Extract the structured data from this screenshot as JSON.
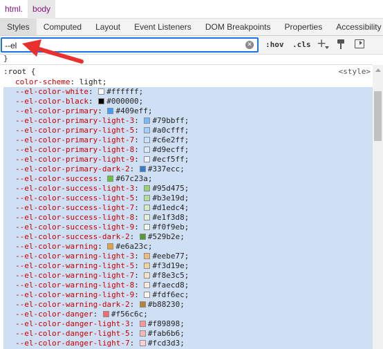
{
  "breadcrumb": {
    "items": [
      "html.",
      "body"
    ]
  },
  "tabs": [
    "Styles",
    "Computed",
    "Layout",
    "Event Listeners",
    "DOM Breakpoints",
    "Properties",
    "Accessibility"
  ],
  "filter": {
    "value": "--el",
    "hov": ":hov",
    "cls": ".cls"
  },
  "closing_brace": "}",
  "rule": {
    "selector": ":root {",
    "origin": "<style>",
    "color_scheme": {
      "prop": "color-scheme",
      "value": "light"
    },
    "declarations": [
      {
        "prop": "--el-color-white",
        "value": "#ffffff"
      },
      {
        "prop": "--el-color-black",
        "value": "#000000"
      },
      {
        "prop": "--el-color-primary",
        "value": "#409eff"
      },
      {
        "prop": "--el-color-primary-light-3",
        "value": "#79bbff"
      },
      {
        "prop": "--el-color-primary-light-5",
        "value": "#a0cfff"
      },
      {
        "prop": "--el-color-primary-light-7",
        "value": "#c6e2ff"
      },
      {
        "prop": "--el-color-primary-light-8",
        "value": "#d9ecff"
      },
      {
        "prop": "--el-color-primary-light-9",
        "value": "#ecf5ff"
      },
      {
        "prop": "--el-color-primary-dark-2",
        "value": "#337ecc"
      },
      {
        "prop": "--el-color-success",
        "value": "#67c23a"
      },
      {
        "prop": "--el-color-success-light-3",
        "value": "#95d475"
      },
      {
        "prop": "--el-color-success-light-5",
        "value": "#b3e19d"
      },
      {
        "prop": "--el-color-success-light-7",
        "value": "#d1edc4"
      },
      {
        "prop": "--el-color-success-light-8",
        "value": "#e1f3d8"
      },
      {
        "prop": "--el-color-success-light-9",
        "value": "#f0f9eb"
      },
      {
        "prop": "--el-color-success-dark-2",
        "value": "#529b2e"
      },
      {
        "prop": "--el-color-warning",
        "value": "#e6a23c"
      },
      {
        "prop": "--el-color-warning-light-3",
        "value": "#eebe77"
      },
      {
        "prop": "--el-color-warning-light-5",
        "value": "#f3d19e"
      },
      {
        "prop": "--el-color-warning-light-7",
        "value": "#f8e3c5"
      },
      {
        "prop": "--el-color-warning-light-8",
        "value": "#faecd8"
      },
      {
        "prop": "--el-color-warning-light-9",
        "value": "#fdf6ec"
      },
      {
        "prop": "--el-color-warning-dark-2",
        "value": "#b88230"
      },
      {
        "prop": "--el-color-danger",
        "value": "#f56c6c"
      },
      {
        "prop": "--el-color-danger-light-3",
        "value": "#f89898"
      },
      {
        "prop": "--el-color-danger-light-5",
        "value": "#fab6b6"
      },
      {
        "prop": "--el-color-danger-light-7",
        "value": "#fcd3d3"
      }
    ]
  },
  "colors": {
    "accent": "#1a73e8",
    "property": "#c80000",
    "highlight": "#d0e0f4",
    "annotation": "#e8312f"
  },
  "icons": [
    "clear-icon",
    "plus-icon",
    "paint-icon",
    "sidebar-toggle-icon"
  ]
}
